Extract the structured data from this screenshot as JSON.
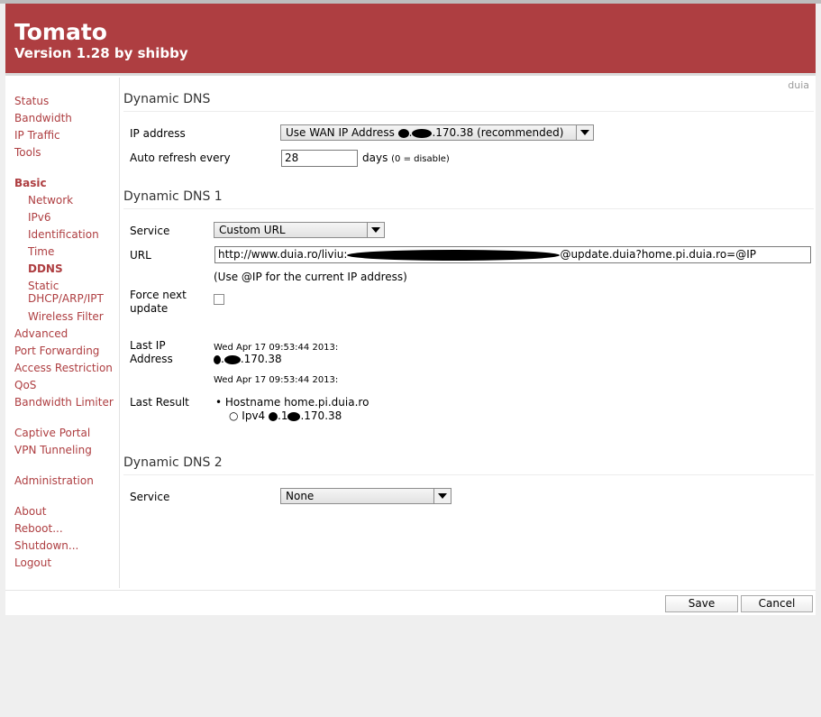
{
  "header": {
    "title": "Tomato",
    "version": "Version 1.28 by shibby"
  },
  "router_name": "duia",
  "sidebar": {
    "items": [
      {
        "label": "Status"
      },
      {
        "label": "Bandwidth"
      },
      {
        "label": "IP Traffic"
      },
      {
        "label": "Tools"
      },
      {
        "label": "Basic"
      },
      {
        "label": "Network"
      },
      {
        "label": "IPv6"
      },
      {
        "label": "Identification"
      },
      {
        "label": "Time"
      },
      {
        "label": "DDNS"
      },
      {
        "label": "Static DHCP/ARP/IPT"
      },
      {
        "label": "Wireless Filter"
      },
      {
        "label": "Advanced"
      },
      {
        "label": "Port Forwarding"
      },
      {
        "label": "Access Restriction"
      },
      {
        "label": "QoS"
      },
      {
        "label": "Bandwidth Limiter"
      },
      {
        "label": "Captive Portal"
      },
      {
        "label": "VPN Tunneling"
      },
      {
        "label": "Administration"
      },
      {
        "label": "About"
      },
      {
        "label": "Reboot..."
      },
      {
        "label": "Shutdown..."
      },
      {
        "label": "Logout"
      }
    ],
    "static_line1": "Static",
    "static_line2": "DHCP/ARP/IPT"
  },
  "ddns": {
    "title": "Dynamic DNS",
    "ip_label": "IP address",
    "ip_select_prefix": "Use WAN IP Address ",
    "ip_select_suffix": ".170.38 (recommended)",
    "refresh_label": "Auto refresh every",
    "refresh_value": "28",
    "refresh_unit": "days",
    "refresh_hint": "(0 = disable)"
  },
  "ddns1": {
    "title": "Dynamic DNS 1",
    "service_label": "Service",
    "service_value": "Custom URL",
    "url_label": "URL",
    "url_prefix": "http://www.duia.ro/liviu:",
    "url_suffix": "@update.duia?home.pi.duia.ro=@IP",
    "url_hint": "(Use @IP for the current IP address)",
    "force_label_1": "Force next",
    "force_label_2": "update",
    "last_ip_label_1": "Last IP",
    "last_ip_label_2": "Address",
    "last_ip_time": "Wed Apr 17 09:53:44 2013:",
    "last_ip_suffix": ".170.38",
    "last_result_time": "Wed Apr 17 09:53:44 2013:",
    "last_result_label": "Last Result",
    "hostname_text": "Hostname home.pi.duia.ro",
    "ipv4_prefix": "Ipv4 ",
    "ipv4_suffix": ".170.38"
  },
  "ddns2": {
    "title": "Dynamic DNS 2",
    "service_label": "Service",
    "service_value": "None"
  },
  "buttons": {
    "save": "Save",
    "cancel": "Cancel"
  }
}
